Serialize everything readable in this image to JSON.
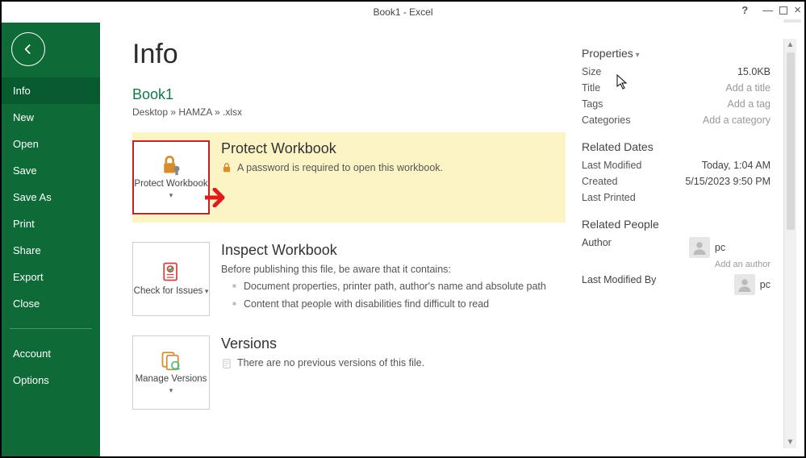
{
  "window": {
    "title": "Book1 - Excel"
  },
  "sidebar": {
    "items": [
      {
        "label": "Info",
        "active": true
      },
      {
        "label": "New"
      },
      {
        "label": "Open"
      },
      {
        "label": "Save"
      },
      {
        "label": "Save As"
      },
      {
        "label": "Print"
      },
      {
        "label": "Share"
      },
      {
        "label": "Export"
      },
      {
        "label": "Close"
      }
    ],
    "footer": [
      {
        "label": "Account"
      },
      {
        "label": "Options"
      }
    ]
  },
  "page": {
    "title": "Info",
    "file_name": "Book1",
    "breadcrumb": "Desktop » HAMZA » .xlsx"
  },
  "sections": {
    "protect": {
      "tile_label": "Protect Workbook",
      "title": "Protect Workbook",
      "msg": "A password is required to open this workbook."
    },
    "inspect": {
      "tile_label": "Check for Issues",
      "title": "Inspect Workbook",
      "sub": "Before publishing this file, be aware that it contains:",
      "bullets": [
        "Document properties, printer path, author's name and absolute path",
        "Content that people with disabilities find difficult to read"
      ]
    },
    "versions": {
      "tile_label": "Manage Versions",
      "title": "Versions",
      "msg": "There are no previous versions of this file."
    }
  },
  "properties": {
    "heading": "Properties",
    "rows": [
      {
        "label": "Size",
        "value": "15.0KB"
      },
      {
        "label": "Title",
        "placeholder": "Add a title"
      },
      {
        "label": "Tags",
        "placeholder": "Add a tag"
      },
      {
        "label": "Categories",
        "placeholder": "Add a category"
      }
    ],
    "dates_heading": "Related Dates",
    "dates": [
      {
        "label": "Last Modified",
        "value": "Today, 1:04 AM"
      },
      {
        "label": "Created",
        "value": "5/15/2023 9:50 PM"
      },
      {
        "label": "Last Printed",
        "value": ""
      }
    ],
    "people_heading": "Related People",
    "author_label": "Author",
    "author_name": "pc",
    "add_author": "Add an author",
    "modified_by_label": "Last Modified By",
    "modified_by_name": "pc"
  }
}
